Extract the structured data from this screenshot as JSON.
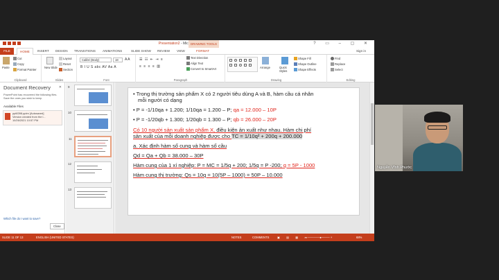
{
  "window": {
    "title_doc": "Presentation2",
    "title_app": " - Microsoft PowerPoint",
    "drawing_tools": "DRAWING TOOLS",
    "window_controls": "?  ▭  –  ▢  ✕"
  },
  "tabs": [
    "FILE",
    "HOME",
    "INSERT",
    "DESIGN",
    "TRANSITIONS",
    "ANIMATIONS",
    "SLIDE SHOW",
    "REVIEW",
    "VIEW",
    "FORMAT"
  ],
  "sign_in": "Sign in",
  "ribbon": {
    "clipboard": {
      "label": "Clipboard",
      "paste": "Paste",
      "cut": "Cut",
      "copy": "Copy",
      "format_painter": "Format Painter"
    },
    "slides": {
      "label": "Slides",
      "new_slide": "New Slide",
      "layout": "Layout",
      "reset": "Reset",
      "section": "Section"
    },
    "font": {
      "label": "Font",
      "font_name": "Calibri (Body)",
      "font_size": "18",
      "format_row": "B  I  U  S  abc  AV  Aa  A"
    },
    "paragraph": {
      "label": "Paragraph",
      "text_direction": "Text Direction",
      "align_text": "Align Text",
      "convert_smartart": "Convert to SmartArt"
    },
    "drawing": {
      "label": "Drawing",
      "arrange": "Arrange",
      "quick_styles": "Quick Styles",
      "shape_fill": "Shape Fill",
      "shape_outline": "Shape Outline",
      "shape_effects": "Shape Effects"
    },
    "editing": {
      "label": "Editing",
      "find": "Find",
      "replace": "Replace",
      "select": "Select"
    }
  },
  "recovery": {
    "title": "Document Recovery",
    "description": "PowerPoint has recovered the following files.  Save the ones you wish to keep.",
    "available_files": "Available Files",
    "file_name": "ppt8398.pptm  [Autosaved]",
    "file_line2": "Version created from the l...",
    "file_line3": "10/26/2021 10:57 PM",
    "which_file": "Which file do I want to save?",
    "close": "Close"
  },
  "thumbnails": [
    {
      "num": "9"
    },
    {
      "num": "10"
    },
    {
      "num": "11"
    },
    {
      "num": "12"
    },
    {
      "num": "13"
    }
  ],
  "slide": {
    "line1": "Trong thị trường sản phẩm X có 2 người tiêu dùng A và B, hàm cầu cá nhân",
    "line1b": "mỗi người có dạng",
    "line2a": "P = -1/10qa + 1.200; 1/10qa = 1.200 – P; ",
    "line2b": "qa = 12.000 – 10P",
    "line3a": "P = -1/20qb + 1.300; 1/20qb = 1.300 – P; ",
    "line3b": "qb = 26.000 – 20P",
    "line4": "Có 10 người sản xuất sản phẩm X,",
    "line4b": " điều kiện ản xuất như nhau. Hàm chi phí",
    "line5a": "sản xuất của mỗi doanh nghiệp được cho ",
    "line5b": "TC = 1/10q² + 200q + 200.000",
    "line6": "a.  Xác định hàm số cung và hàm số cầu",
    "line7": "Qd = Qa + Qb = 38.000 – 30P",
    "line8a": "Hàm cung của 1 xí nghiệp: P = MC = 1/5q + 200; 1/5q = P -200; ",
    "line8b": "q = 5P - 1000",
    "line9": "Hàm cung thị trường: Qs = 10q = 10(5P – 1000) = 50P – 10.000"
  },
  "status": {
    "slide_count": "SLIDE 11 OF 13",
    "language": "ENGLISH (UNITED STATES)",
    "notes": "NOTES",
    "comments": "COMMENTS",
    "zoom": "68%"
  },
  "webcam": {
    "name": "Nguyễn Vĩnh Phước"
  },
  "colors": {
    "accent": "#c43e1c",
    "highlight_red": "#e0241b"
  }
}
